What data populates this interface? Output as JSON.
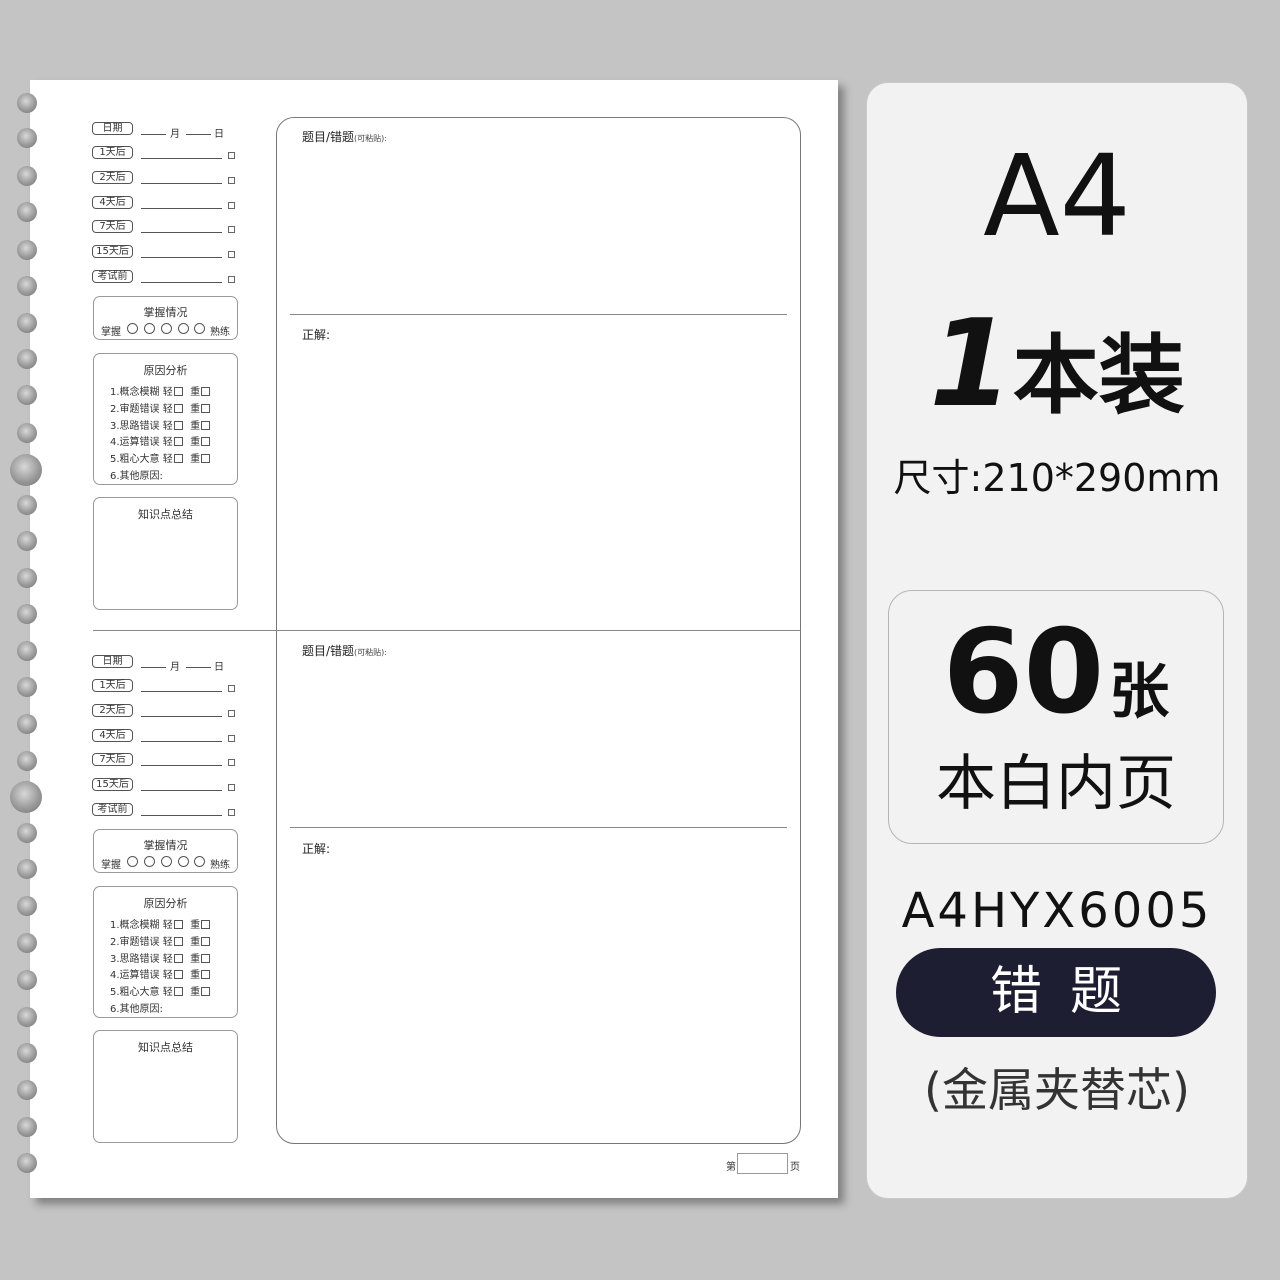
{
  "sheet": {
    "date_label": "日期",
    "month_char": "月",
    "day_char": "日",
    "review_items": [
      "1天后",
      "2天后",
      "4天后",
      "7天后",
      "15天后",
      "考试前"
    ],
    "mastery": {
      "title": "掌握情况",
      "left": "掌握",
      "right": "熟练"
    },
    "reason": {
      "title": "原因分析",
      "items": [
        "1.概念模糊",
        "2.审题错误",
        "3.思路错误",
        "4.运算错误",
        "5.粗心大意"
      ],
      "light": "轻",
      "heavy": "重",
      "other": "6.其他原因:"
    },
    "knowledge_title": "知识点总结",
    "question_label": "题目/错题",
    "question_note": "(可粘贴)",
    "question_colon": ":",
    "answer_label": "正解:",
    "page_prefix": "第",
    "page_suffix": "页"
  },
  "card": {
    "format": "A4",
    "count_num": "1",
    "count_unit": "本装",
    "size": "尺寸:210*290mm",
    "sheets_num": "60",
    "sheets_unit": "张",
    "paper_type": "本白内页",
    "model": "A4HYX6005",
    "category": "错题",
    "note": "(金属夹替芯)"
  },
  "colors": {
    "background": "#c4c4c4",
    "card": "#f2f2f2",
    "pill": "#1e1e32"
  }
}
